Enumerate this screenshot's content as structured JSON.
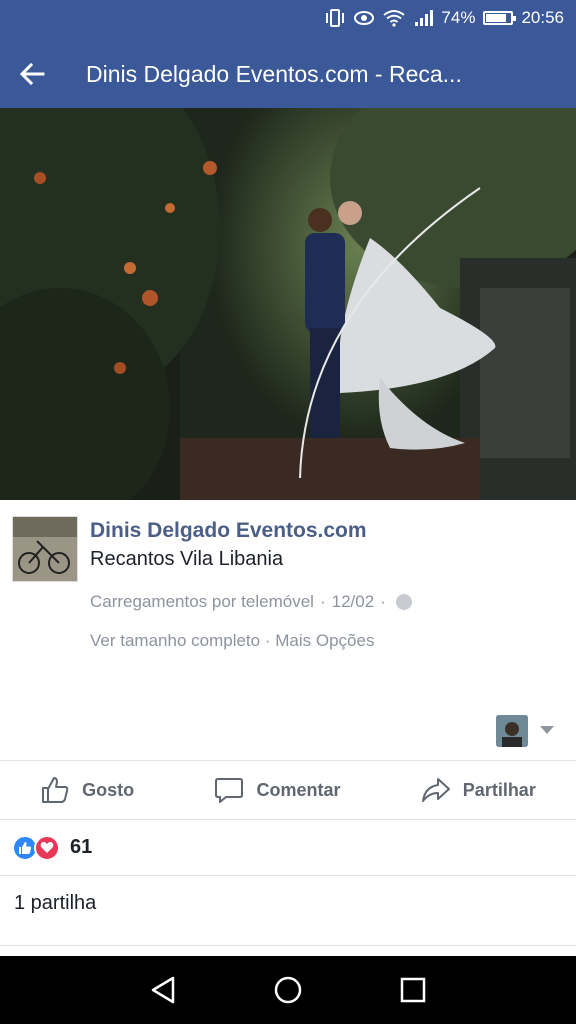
{
  "status_bar": {
    "battery": "74%",
    "time": "20:56",
    "battery_level": 0.74,
    "icons": [
      "vibrate-icon",
      "eye-icon",
      "wifi-icon",
      "signal-icon",
      "battery-icon"
    ]
  },
  "app_bar": {
    "title": "Dinis Delgado Eventos.com - Reca...",
    "back_icon": "back-arrow-icon",
    "background_color": "#3b5998"
  },
  "post": {
    "page_name": "Dinis Delgado Eventos.com",
    "caption": "Recantos Vila Libania",
    "source": "Carregamentos por telemóvel",
    "date": "12/02",
    "separator": "·",
    "view_full_size": "Ver tamanho completo",
    "more_options": "Mais Opções"
  },
  "actions": {
    "like": "Gosto",
    "comment": "Comentar",
    "share": "Partilhar"
  },
  "reactions": {
    "count": "61",
    "types": [
      "like",
      "love"
    ]
  },
  "shares": {
    "text": "1 partilha"
  },
  "colors": {
    "brand": "#3b5998",
    "link_gray": "#8d949e",
    "page_name": "#4b5f86"
  }
}
